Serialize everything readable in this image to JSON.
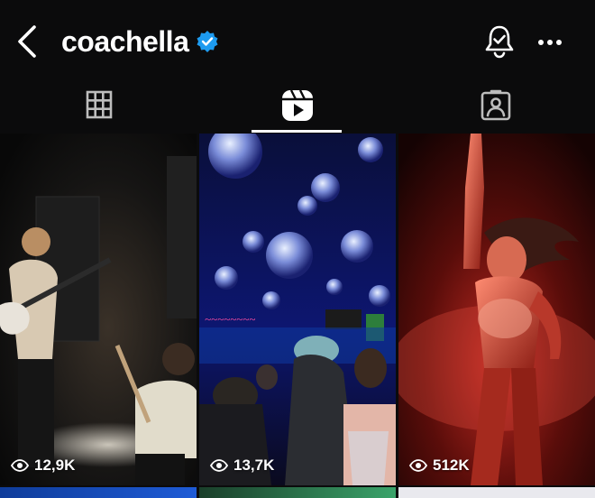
{
  "header": {
    "back_icon": "chevron-left-icon",
    "username": "coachella",
    "verified_icon": "verified-badge-icon",
    "verified_color": "#1d9bf0",
    "bell_icon": "notification-bell-icon",
    "more_icon": "more-horizontal-icon"
  },
  "tabs": [
    {
      "icon": "grid-icon",
      "active": false
    },
    {
      "icon": "reels-icon",
      "active": true
    },
    {
      "icon": "tagged-icon",
      "active": false
    }
  ],
  "reels": [
    {
      "views": "12,9K",
      "view_icon": "eye-icon"
    },
    {
      "views": "13,7K",
      "view_icon": "eye-icon"
    },
    {
      "views": "512K",
      "view_icon": "eye-icon"
    }
  ]
}
